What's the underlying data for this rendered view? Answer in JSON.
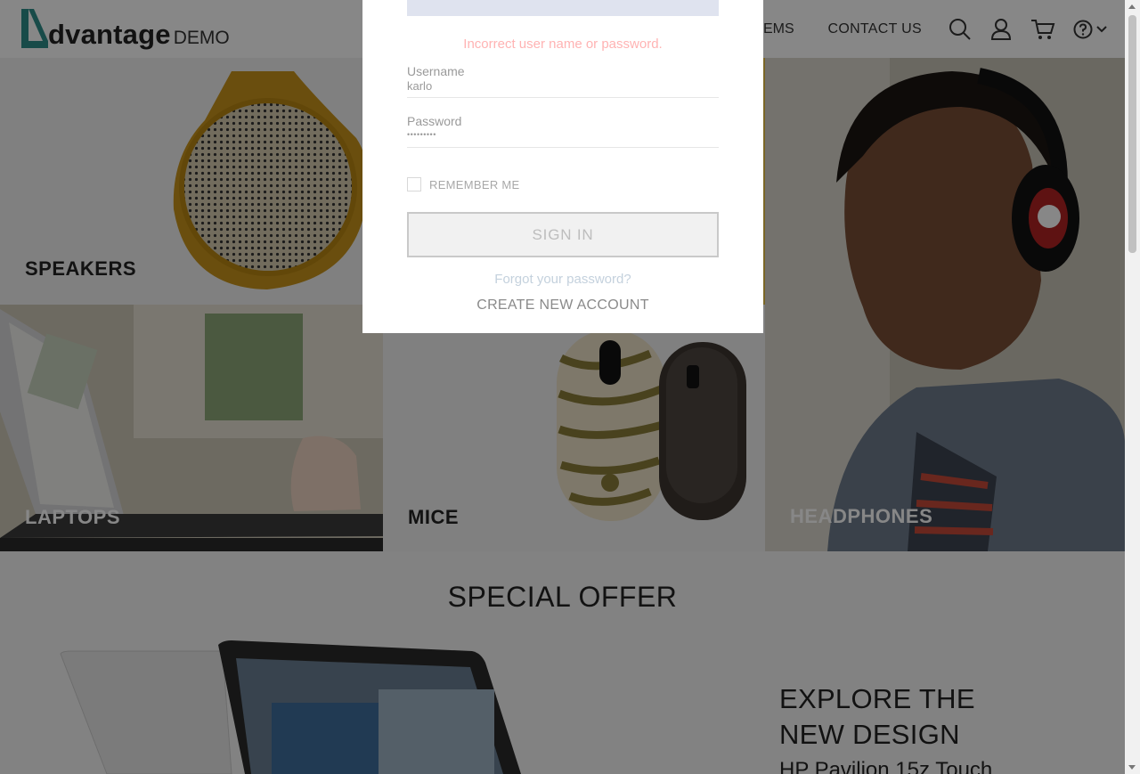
{
  "header": {
    "logo_word": "dvantage",
    "logo_suffix": "DEMO",
    "nav_partial": "EMS",
    "nav_contact": "CONTACT US",
    "icons": [
      "search-icon",
      "user-icon",
      "cart-icon",
      "help-icon",
      "chevron-down-icon"
    ]
  },
  "categories": {
    "speakers": "SPEAKERS",
    "laptops": "LAPTOPS",
    "mice": "MICE",
    "headphones": "HEADPHONES"
  },
  "special_offer": {
    "title": "SPECIAL OFFER",
    "headline": "EXPLORE THE NEW DESIGN",
    "subtitle": "HP Pavilion 15z Touch"
  },
  "login": {
    "error": "Incorrect user name or password.",
    "username_label": "Username",
    "username_value": "karlo",
    "password_label": "Password",
    "password_value": "•••••••••",
    "remember_label": "REMEMBER ME",
    "signin_label": "SIGN IN",
    "forgot_label": "Forgot your password?",
    "create_label": "CREATE NEW ACCOUNT"
  },
  "colors": {
    "brand": "#2f8f8a",
    "error": "#ffb3b3"
  }
}
